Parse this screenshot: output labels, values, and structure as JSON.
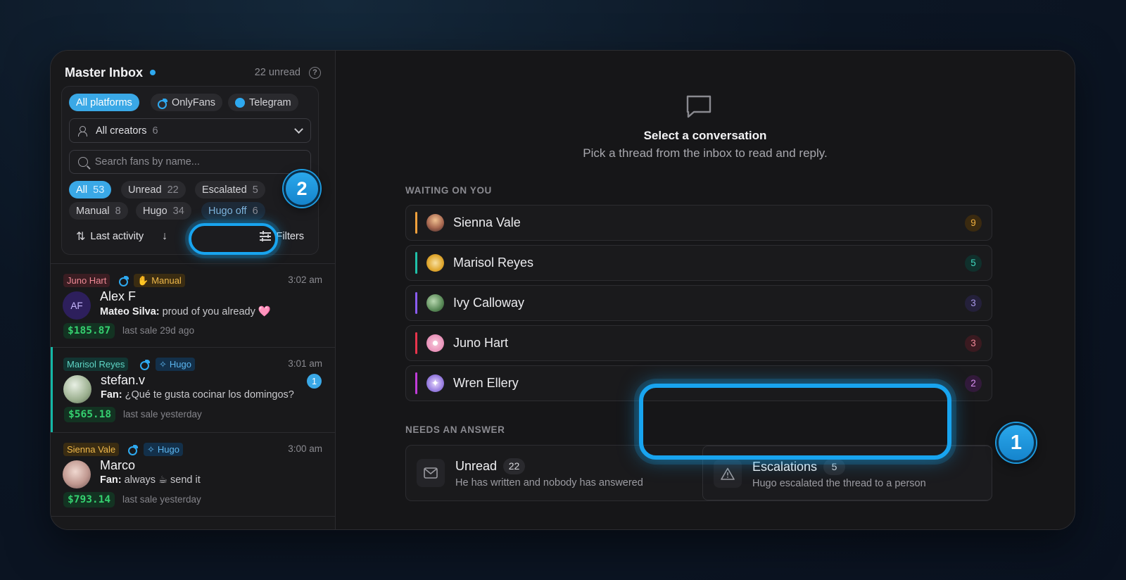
{
  "inbox": {
    "title": "Master Inbox",
    "unread": "22 unread",
    "help": "?"
  },
  "platforms": [
    {
      "label": "All platforms",
      "active": true
    },
    {
      "label": "OnlyFans",
      "icon": "onlyfans-icon"
    },
    {
      "label": "Telegram",
      "icon": "telegram-icon"
    }
  ],
  "creator_select": {
    "label": "All creators",
    "count": "6"
  },
  "search": {
    "placeholder": "Search fans by name..."
  },
  "status_filters": [
    {
      "label": "All",
      "count": "53",
      "active": true
    },
    {
      "label": "Unread",
      "count": "22"
    },
    {
      "label": "Escalated",
      "count": "5",
      "highlighted": true
    },
    {
      "label": "Manual",
      "count": "8"
    },
    {
      "label": "Hugo",
      "count": "34"
    },
    {
      "label": "Hugo off",
      "count": "6"
    }
  ],
  "sort": {
    "label": "Last activity",
    "filters_label": "Filters"
  },
  "callouts": {
    "one": "1",
    "two": "2"
  },
  "conversations": [
    {
      "creator": "Juno Hart",
      "mode": "Manual",
      "time": "3:02 am",
      "initials": "AF",
      "fan": "Alex F",
      "sender": "Mateo Silva:",
      "message": "proud of you already 🩷",
      "amount": "$185.87",
      "last_sale": "last sale 29d ago"
    },
    {
      "creator": "Marisol Reyes",
      "mode": "Hugo",
      "time": "3:01 am",
      "unread": "1",
      "fan": "stefan.v",
      "sender": "Fan:",
      "message": "¿Qué te gusta cocinar los domingos?",
      "amount": "$565.18",
      "last_sale": "last sale yesterday"
    },
    {
      "creator": "Sienna Vale",
      "mode": "Hugo",
      "time": "3:00 am",
      "fan": "Marco",
      "sender": "Fan:",
      "message": "always ☕ send it",
      "amount": "$793.14",
      "last_sale": "last sale yesterday"
    }
  ],
  "empty_state": {
    "title": "Select a conversation",
    "subtitle": "Pick a thread from the inbox to read and reply."
  },
  "waiting": {
    "label": "WAITING ON YOU",
    "items": [
      {
        "name": "Sienna Vale",
        "count": "9",
        "color": "#f0a03c"
      },
      {
        "name": "Marisol Reyes",
        "count": "5",
        "color": "#20c0a8"
      },
      {
        "name": "Ivy Calloway",
        "count": "3",
        "color": "#8a5cf0"
      },
      {
        "name": "Juno Hart",
        "count": "3",
        "color": "#e8344c"
      },
      {
        "name": "Wren Ellery",
        "count": "2",
        "color": "#c03cd8"
      }
    ]
  },
  "needs_answer": {
    "label": "NEEDS AN ANSWER",
    "unread": {
      "title": "Unread",
      "count": "22",
      "subtitle": "He has written and nobody has answered"
    },
    "escalations": {
      "title": "Escalations",
      "count": "5",
      "subtitle": "Hugo escalated the thread to a person"
    }
  }
}
